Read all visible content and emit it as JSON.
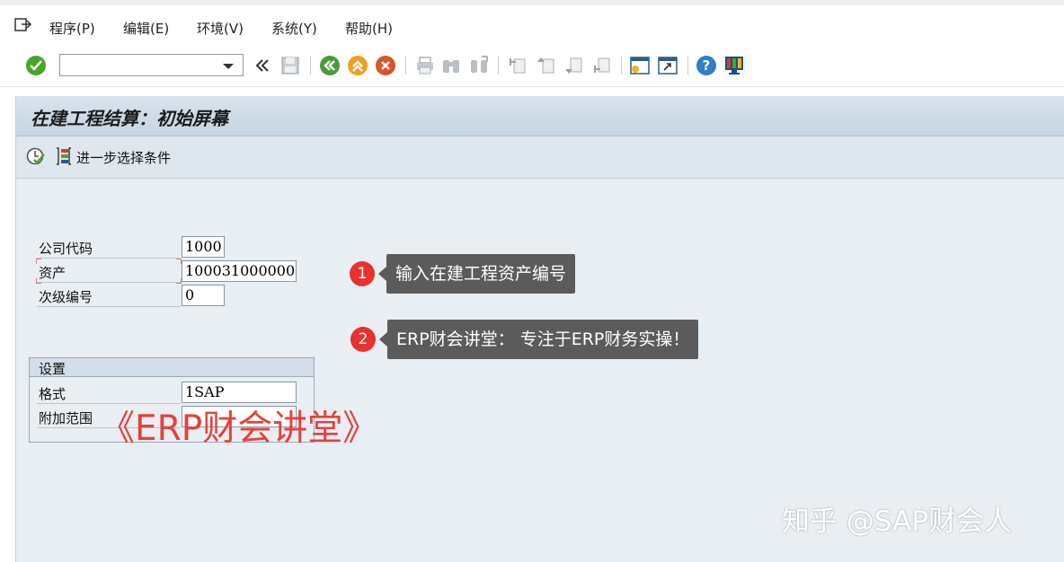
{
  "menu": {
    "items": [
      "程序(P)",
      "编辑(E)",
      "环境(V)",
      "系统(Y)",
      "帮助(H)"
    ]
  },
  "toolbar": {
    "command_value": "",
    "icons": [
      "enter-icon",
      "command-dropdown-icon",
      "collapse-icon",
      "save-icon",
      "back-icon",
      "exit-icon",
      "cancel-icon",
      "print-icon",
      "find-icon",
      "find-next-icon",
      "first-page-icon",
      "previous-page-icon",
      "next-page-icon",
      "last-page-icon",
      "new-session-icon",
      "shortcut-icon",
      "help-icon",
      "customize-layout-icon"
    ]
  },
  "page": {
    "title": "在建工程结算：初始屏幕",
    "further_selection": "进一步选择条件"
  },
  "form": {
    "company_code": {
      "label": "公司代码",
      "value": "1000"
    },
    "asset": {
      "label": "资产",
      "value": "100031000000"
    },
    "sub_number": {
      "label": "次级编号",
      "value": "0"
    }
  },
  "settings": {
    "title": "设置",
    "layout": {
      "label": "格式",
      "value": "1SAP"
    },
    "additional_scope": {
      "label": "附加范围",
      "value": ""
    }
  },
  "annotations": [
    {
      "number": "1",
      "text": "输入在建工程资产编号"
    },
    {
      "number": "2",
      "text": "ERP财会讲堂： 专注于ERP财务实操！"
    }
  ],
  "watermarks": {
    "red": "《ERP财会讲堂》",
    "zhihu": "知乎 @SAP财会人"
  },
  "colors": {
    "accent_green": "#4aa32d",
    "badge_red": "#e7322f",
    "callout_gray": "#5b5b5b",
    "title_bar": "#c7d6e3"
  }
}
